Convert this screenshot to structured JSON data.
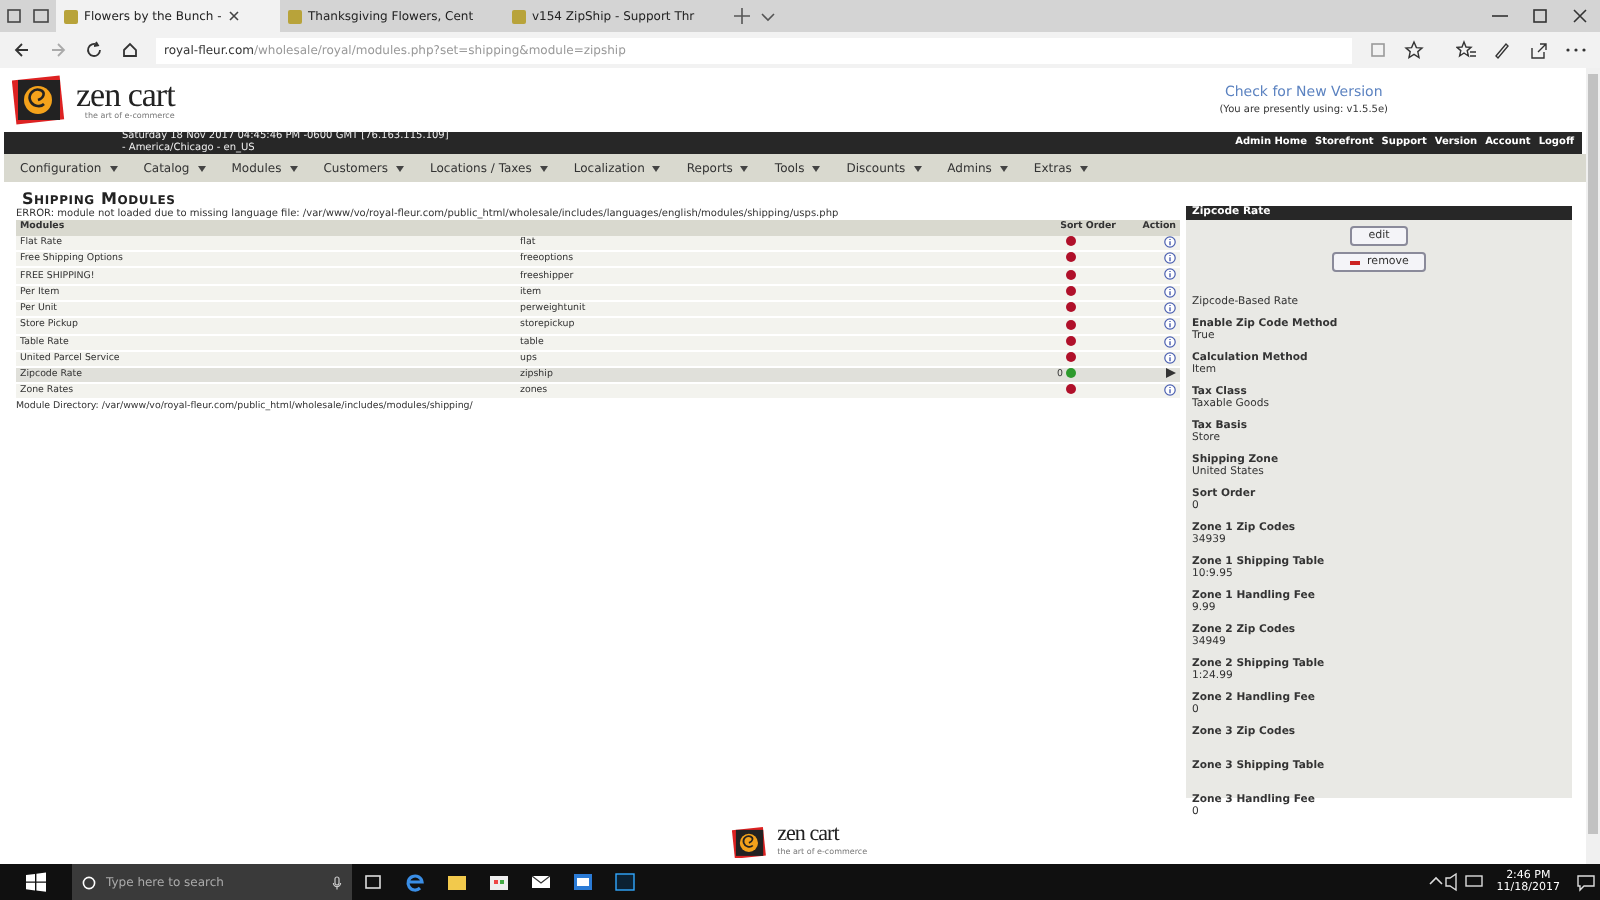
{
  "browser": {
    "tabs": [
      {
        "title": "Flowers by the Bunch -",
        "selected": true
      },
      {
        "title": "Thanksgiving Flowers, Cent",
        "selected": false
      },
      {
        "title": "v154 ZipShip - Support Thr",
        "selected": false
      }
    ],
    "address": {
      "domain": "royal-fleur.com",
      "path": "/wholesale/royal/modules.php?set=shipping&module=zipship"
    }
  },
  "header": {
    "logo": {
      "name": "zen cart",
      "tagline": "the art of e-commerce"
    },
    "version_link": "Check for New Version",
    "version_note": "(You are presently using: v1.5.5e)",
    "date_line": "Saturday 18 Nov 2017 04:45:46 PM -0600 GMT [76.163.115.109]",
    "locale_line": "- America/Chicago - en_US",
    "top_links": [
      "Admin Home",
      "Storefront",
      "Support",
      "Version",
      "Account",
      "Logoff"
    ],
    "menu": [
      "Configuration",
      "Catalog",
      "Modules",
      "Customers",
      "Locations / Taxes",
      "Localization",
      "Reports",
      "Tools",
      "Discounts",
      "Admins",
      "Extras"
    ]
  },
  "page": {
    "title": "Shipping Modules",
    "error": "ERROR: module not loaded due to missing language file: /var/www/vo/royal-fleur.com/public_html/wholesale/includes/languages/english/modules/shipping/usps.php",
    "columns": [
      "Modules",
      "Sort Order",
      "Action"
    ],
    "rows": [
      {
        "name": "Flat Rate",
        "code": "flat",
        "sort_order": "",
        "enabled": false,
        "selected": false
      },
      {
        "name": "Free Shipping Options",
        "code": "freeoptions",
        "sort_order": "",
        "enabled": false,
        "selected": false
      },
      {
        "name": "FREE SHIPPING!",
        "code": "freeshipper",
        "sort_order": "",
        "enabled": false,
        "selected": false
      },
      {
        "name": "Per Item",
        "code": "item",
        "sort_order": "",
        "enabled": false,
        "selected": false
      },
      {
        "name": "Per Unit",
        "code": "perweightunit",
        "sort_order": "",
        "enabled": false,
        "selected": false
      },
      {
        "name": "Store Pickup",
        "code": "storepickup",
        "sort_order": "",
        "enabled": false,
        "selected": false
      },
      {
        "name": "Table Rate",
        "code": "table",
        "sort_order": "",
        "enabled": false,
        "selected": false
      },
      {
        "name": "United Parcel Service",
        "code": "ups",
        "sort_order": "",
        "enabled": false,
        "selected": false
      },
      {
        "name": "Zipcode Rate",
        "code": "zipship",
        "sort_order": "0",
        "enabled": true,
        "selected": true
      },
      {
        "name": "Zone Rates",
        "code": "zones",
        "sort_order": "",
        "enabled": false,
        "selected": false
      }
    ],
    "module_directory": "Module Directory: /var/www/vo/royal-fleur.com/public_html/wholesale/includes/modules/shipping/"
  },
  "panel": {
    "title": "Zipcode Rate",
    "buttons": [
      {
        "label": "edit",
        "kind": "plain"
      },
      {
        "label": "remove",
        "kind": "remove"
      }
    ],
    "description": "Zipcode-Based Rate",
    "fields": [
      {
        "label": "Enable Zip Code Method",
        "value": "True"
      },
      {
        "label": "Calculation Method",
        "value": "Item"
      },
      {
        "label": "Tax Class",
        "value": "Taxable Goods"
      },
      {
        "label": "Tax Basis",
        "value": "Store"
      },
      {
        "label": "Shipping Zone",
        "value": "United States"
      },
      {
        "label": "Sort Order",
        "value": "0"
      },
      {
        "label": "Zone 1 Zip Codes",
        "value": "34939"
      },
      {
        "label": "Zone 1 Shipping Table",
        "value": "10:9.95"
      },
      {
        "label": "Zone 1 Handling Fee",
        "value": "9.99"
      },
      {
        "label": "Zone 2 Zip Codes",
        "value": "34949"
      },
      {
        "label": "Zone 2 Shipping Table",
        "value": "1:24.99"
      },
      {
        "label": "Zone 2 Handling Fee",
        "value": "0"
      },
      {
        "label": "Zone 3 Zip Codes"
      },
      {
        "label": "Zone 3 Shipping Table"
      },
      {
        "label": "Zone 3 Handling Fee",
        "value": "0"
      }
    ]
  },
  "footer": {
    "logo": {
      "name": "zen cart",
      "tagline": "the art of e-commerce"
    }
  },
  "taskbar": {
    "search_placeholder": "Type here to search",
    "time": "2:46 PM",
    "date": "11/18/2017"
  }
}
